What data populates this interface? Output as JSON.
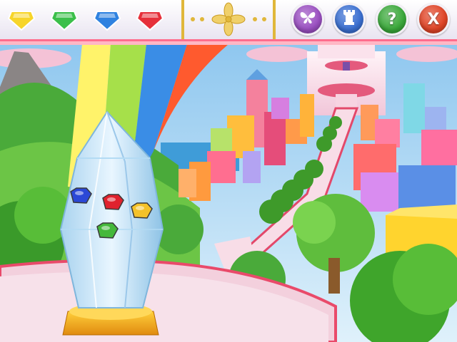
{
  "toolbar": {
    "gems": [
      {
        "name": "yellow-gem",
        "color": "#f7d52a"
      },
      {
        "name": "green-gem",
        "color": "#3bbf4a"
      },
      {
        "name": "blue-gem",
        "color": "#2f82e0"
      },
      {
        "name": "red-gem",
        "color": "#e6303a"
      }
    ],
    "buttons": [
      {
        "name": "butterfly-button",
        "icon": "butterfly-icon",
        "color": "#9a4fc1"
      },
      {
        "name": "castle-button",
        "icon": "castle-rook-icon",
        "color": "#3a6fd1"
      },
      {
        "name": "help-button",
        "icon": "question-icon",
        "label": "?",
        "color": "#3aa83a"
      },
      {
        "name": "close-button",
        "icon": "close-icon",
        "label": "X",
        "color": "#e04426"
      }
    ]
  },
  "scene": {
    "crystal_gems": [
      {
        "name": "crystal-gem-blue",
        "color": "#2b48d6"
      },
      {
        "name": "crystal-gem-red",
        "color": "#e0222e"
      },
      {
        "name": "crystal-gem-yellow",
        "color": "#f4c22a"
      },
      {
        "name": "crystal-gem-green",
        "color": "#45b83a"
      }
    ]
  }
}
